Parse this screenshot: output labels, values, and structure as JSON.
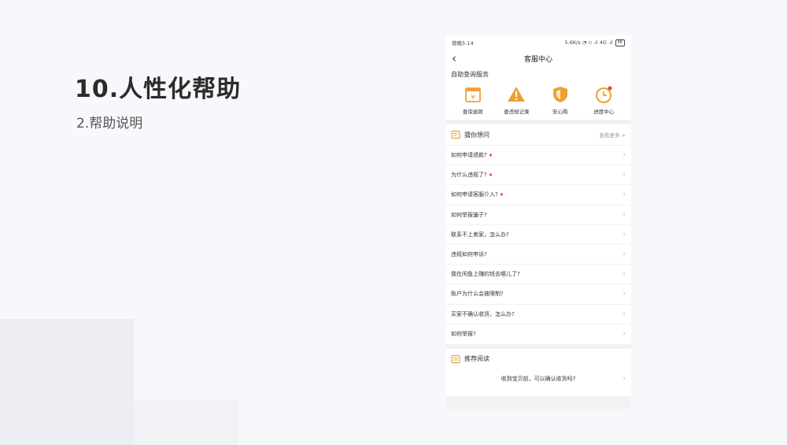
{
  "slide": {
    "title": "10.人性化帮助",
    "subtitle": "2.帮助说明"
  },
  "status_bar": {
    "left": "傍晚5:14",
    "right": "5.6K/s ◔ ▫ .ıl 4G .ıl",
    "battery": "88"
  },
  "nav": {
    "back_icon": "chevron-left-icon",
    "title": "客服中心"
  },
  "self_service": {
    "label": "自助查询服务",
    "items": [
      {
        "label": "查询退款",
        "icon": "refund-icon",
        "color": "#f0a030"
      },
      {
        "label": "查违规记录",
        "icon": "warning-icon",
        "color": "#f0a030"
      },
      {
        "label": "安心购",
        "icon": "shield-icon",
        "color": "#f0a030"
      },
      {
        "label": "进度中心",
        "icon": "clock-icon",
        "color": "#f0a030"
      }
    ]
  },
  "guess": {
    "title": "猜你想问",
    "more": "查看更多 >",
    "questions": [
      {
        "text": "如何申请退款?",
        "hot": true
      },
      {
        "text": "为什么违规了?",
        "hot": true
      },
      {
        "text": "如何申请客服介入?",
        "hot": true
      },
      {
        "text": "如何举报骗子?",
        "hot": false
      },
      {
        "text": "联系不上卖家，怎么办?",
        "hot": false
      },
      {
        "text": "违规如何申诉?",
        "hot": false
      },
      {
        "text": "我在闲鱼上赚的钱去哪儿了?",
        "hot": false
      },
      {
        "text": "账户为什么会被限制?",
        "hot": false
      },
      {
        "text": "买家不确认收货，怎么办?",
        "hot": false
      },
      {
        "text": "如何举报?",
        "hot": false
      }
    ]
  },
  "recommend": {
    "title": "推荐阅读",
    "items": [
      {
        "text": "收到宝贝前，可以确认收货吗?"
      }
    ]
  },
  "colors": {
    "accent": "#f0a030",
    "hot": "#e8452c"
  }
}
